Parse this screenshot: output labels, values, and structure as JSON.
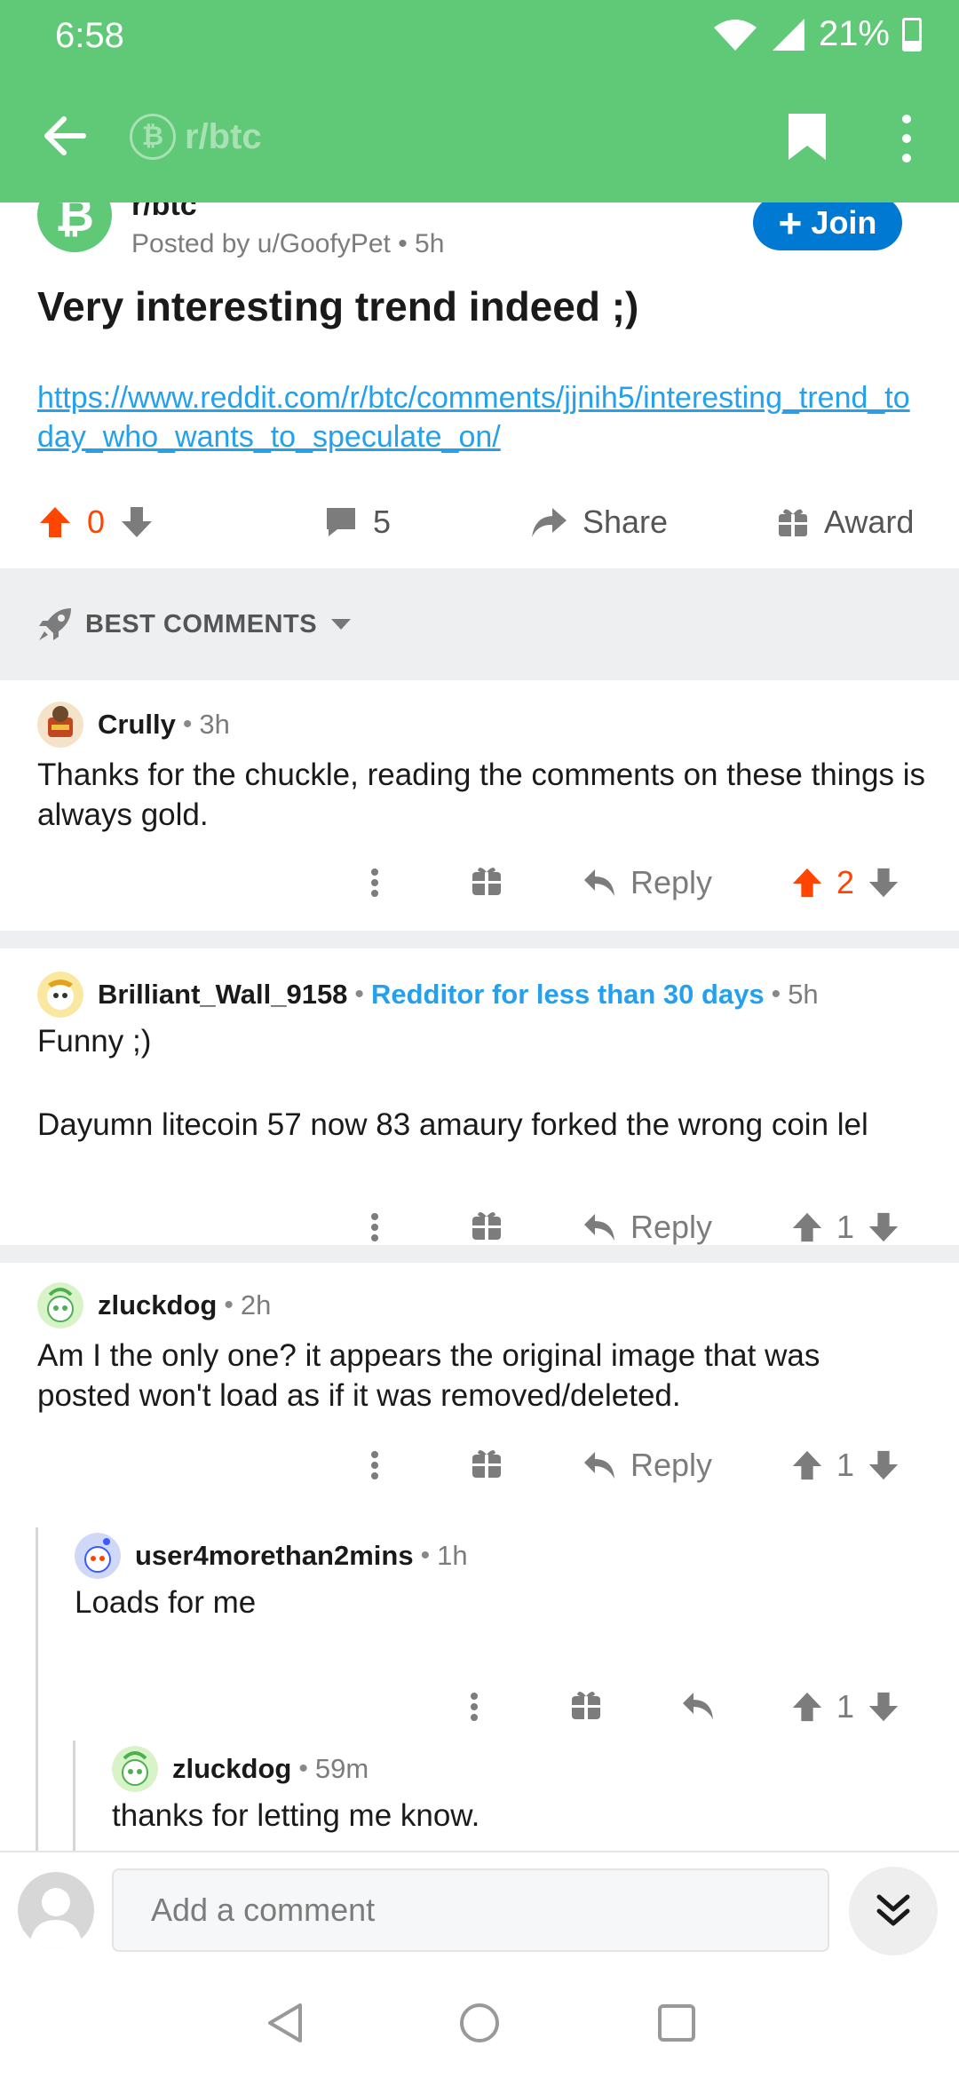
{
  "status_bar": {
    "time": "6:58",
    "battery": "21%"
  },
  "app_bar": {
    "subreddit_chip": "r/btc",
    "icons": [
      "back-arrow-icon",
      "bitcoin-icon",
      "bookmark-icon",
      "more-vertical-icon"
    ]
  },
  "post": {
    "subreddit": "r/btc",
    "avatar_glyph": "₿",
    "posted_by": "Posted by u/GoofyPet",
    "age": "5h",
    "join_label": "Join",
    "title": "Very interesting trend indeed ;)",
    "link": "https://www.reddit.com/r/btc/comments/jjnih5/interesting_trend_today_who_wants_to_speculate_on/",
    "score": "0",
    "comment_count": "5",
    "share_label": "Share",
    "award_label": "Award"
  },
  "sort": {
    "label": "BEST COMMENTS"
  },
  "comments": [
    {
      "author": "Crully",
      "age": "3h",
      "flair": "",
      "body": "Thanks for the chuckle, reading the comments on these things is always gold.",
      "reply_label": "Reply",
      "score": "2",
      "upvoted": true
    },
    {
      "author": "Brilliant_Wall_9158",
      "age": "5h",
      "flair": "Redditor for less than 30 days",
      "body_line1": "Funny ;)",
      "body_line2": "Dayumn litecoin 57 now 83 amaury forked the wrong coin lel",
      "reply_label": "Reply",
      "score": "1"
    },
    {
      "author": "zluckdog",
      "age": "2h",
      "body": "Am I the only one? it appears the original image that was posted won't load as if it was removed/deleted.",
      "reply_label": "Reply",
      "score": "1"
    },
    {
      "author": "user4morethan2mins",
      "age": "1h",
      "body": "Loads for me",
      "score": "1"
    },
    {
      "author": "zluckdog",
      "age": "59m",
      "body": "thanks for letting me know."
    }
  ],
  "compose": {
    "placeholder": "Add a comment"
  },
  "colors": {
    "bar_green": "#5fc977",
    "upvote_orange": "#ff4500",
    "link_blue": "#24a0ed",
    "join_blue": "#0079d3"
  }
}
